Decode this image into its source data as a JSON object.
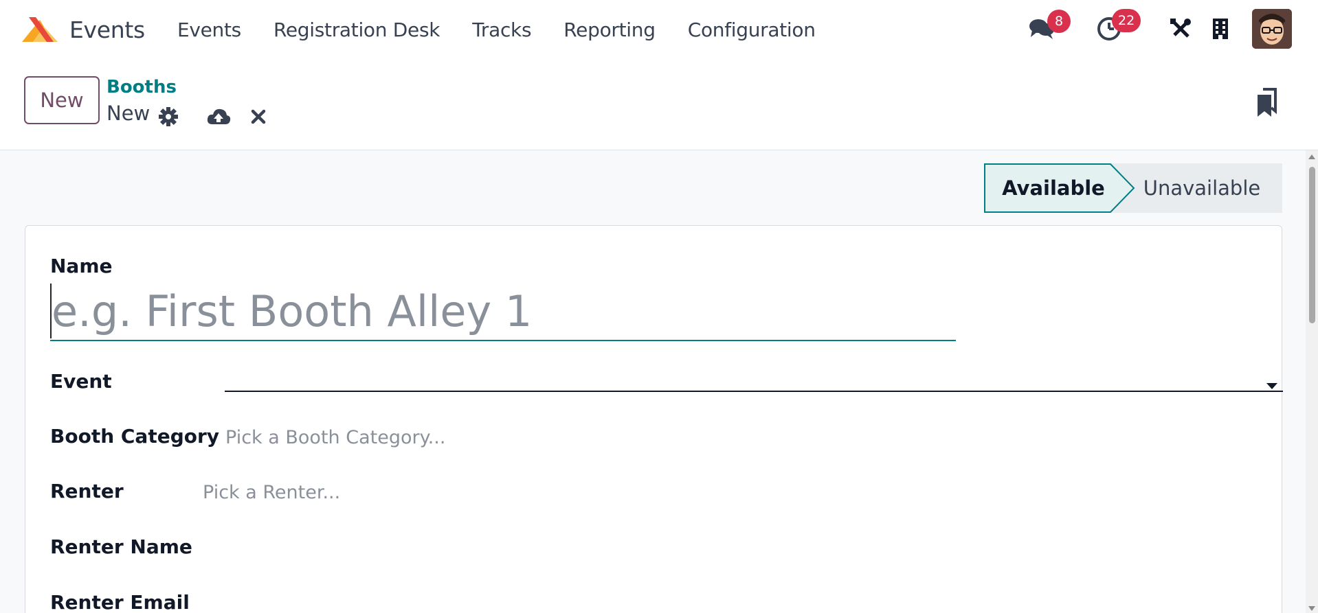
{
  "app": {
    "name": "Events"
  },
  "menu": {
    "items": [
      "Events",
      "Registration Desk",
      "Tracks",
      "Reporting",
      "Configuration"
    ]
  },
  "systray": {
    "messages_count": "8",
    "activities_count": "22"
  },
  "control": {
    "new_button": "New",
    "breadcrumb_parent": "Booths",
    "record_name": "New"
  },
  "status": {
    "stages": [
      "Available",
      "Unavailable"
    ],
    "active": "Available"
  },
  "form": {
    "name_label": "Name",
    "name_placeholder": "e.g. First Booth Alley 1",
    "event_label": "Event",
    "booth_category_label": "Booth Category",
    "booth_category_placeholder": "Pick a Booth Category...",
    "renter_label": "Renter",
    "renter_placeholder": "Pick a Renter...",
    "renter_name_label": "Renter Name",
    "renter_email_label": "Renter Email"
  },
  "colors": {
    "brand": "#714b67",
    "accent": "#017e84",
    "badge": "#d9304e"
  }
}
